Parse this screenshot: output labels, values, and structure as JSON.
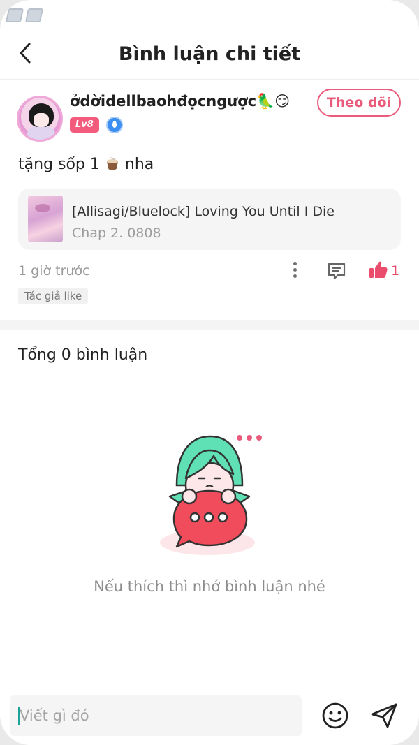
{
  "header": {
    "title": "Bình luận chi tiết"
  },
  "post": {
    "username": "ởdờidellbaohđọcngược🦜😏",
    "level": "Lv8",
    "follow_label": "Theo dõi",
    "content_before": "tặng sốp 1",
    "content_after": " nha",
    "chapter": {
      "title": "[Allisagi/Bluelock] Loving You Until I Die",
      "subtitle": "Chap 2. 0808"
    },
    "time": "1 giờ trước",
    "like_count": "1",
    "author_like_tag": "Tác giả like"
  },
  "comments": {
    "total_label": "Tổng 0 bình luận",
    "empty_text": "Nếu thích thì nhớ bình luận nhé"
  },
  "composer": {
    "placeholder": "Viết gì đó"
  },
  "colors": {
    "accent": "#ea5b7b",
    "level_badge": "#f25b7c",
    "mascot_hair": "#5fe0b5",
    "mascot_bubble": "#f04c5c"
  },
  "icons": {
    "back": "chevron-left-icon",
    "more": "more-vertical-icon",
    "comment": "comment-icon",
    "like": "thumbs-up-icon",
    "emoji": "smiley-icon",
    "send": "send-icon"
  }
}
